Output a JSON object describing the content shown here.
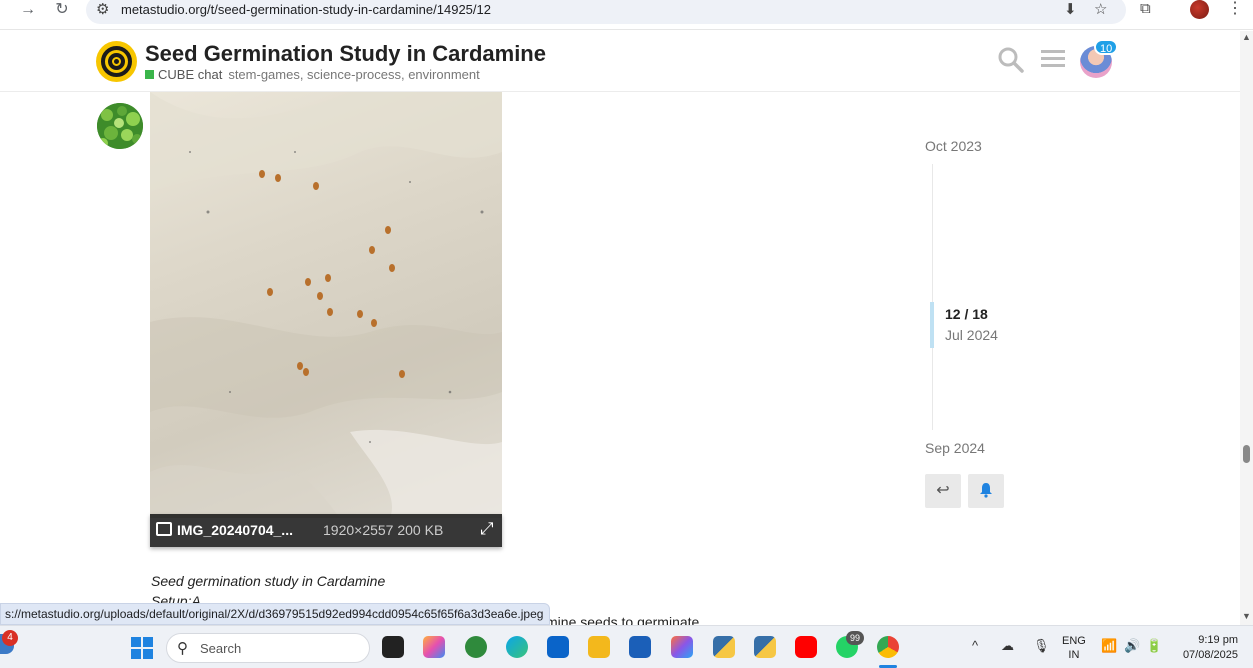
{
  "browser": {
    "url": "metastudio.org/t/seed-germination-study-in-cardamine/14925/12",
    "back_icon": "arrow-left-icon",
    "forward_icon": "arrow-right-icon",
    "reload_icon": "reload-icon",
    "forward_glyph": "→",
    "reload_glyph": "↻"
  },
  "header": {
    "title": "Seed Germination Study in Cardamine",
    "category": "CUBE chat",
    "tags": "stem-games, science-process, environment",
    "category_color": "#3ab54a",
    "notification_count": "10"
  },
  "post": {
    "image_name": "IMG_20240704_...",
    "image_info": "1920×2557 200 KB",
    "text_line1": "Seed germination study in Cardamine",
    "text_line2": "Setup:A",
    "text_line3": "ardamine seeds to germinate"
  },
  "timeline": {
    "start": "Oct 2023",
    "position": "12 / 18",
    "position_date": "Jul 2024",
    "end": "Sep 2024"
  },
  "status_bar": {
    "url": "s://metastudio.org/uploads/default/original/2X/d/d36979515d92ed994cdd0954c65f65f6a3d3ea6e.jpeg"
  },
  "taskbar": {
    "weather_badge": "4",
    "search_placeholder": "Search",
    "whatsapp_badge": "99",
    "lang_top": "ENG",
    "lang_bottom": "IN",
    "time": "9:19 pm",
    "date": "07/08/2025"
  }
}
